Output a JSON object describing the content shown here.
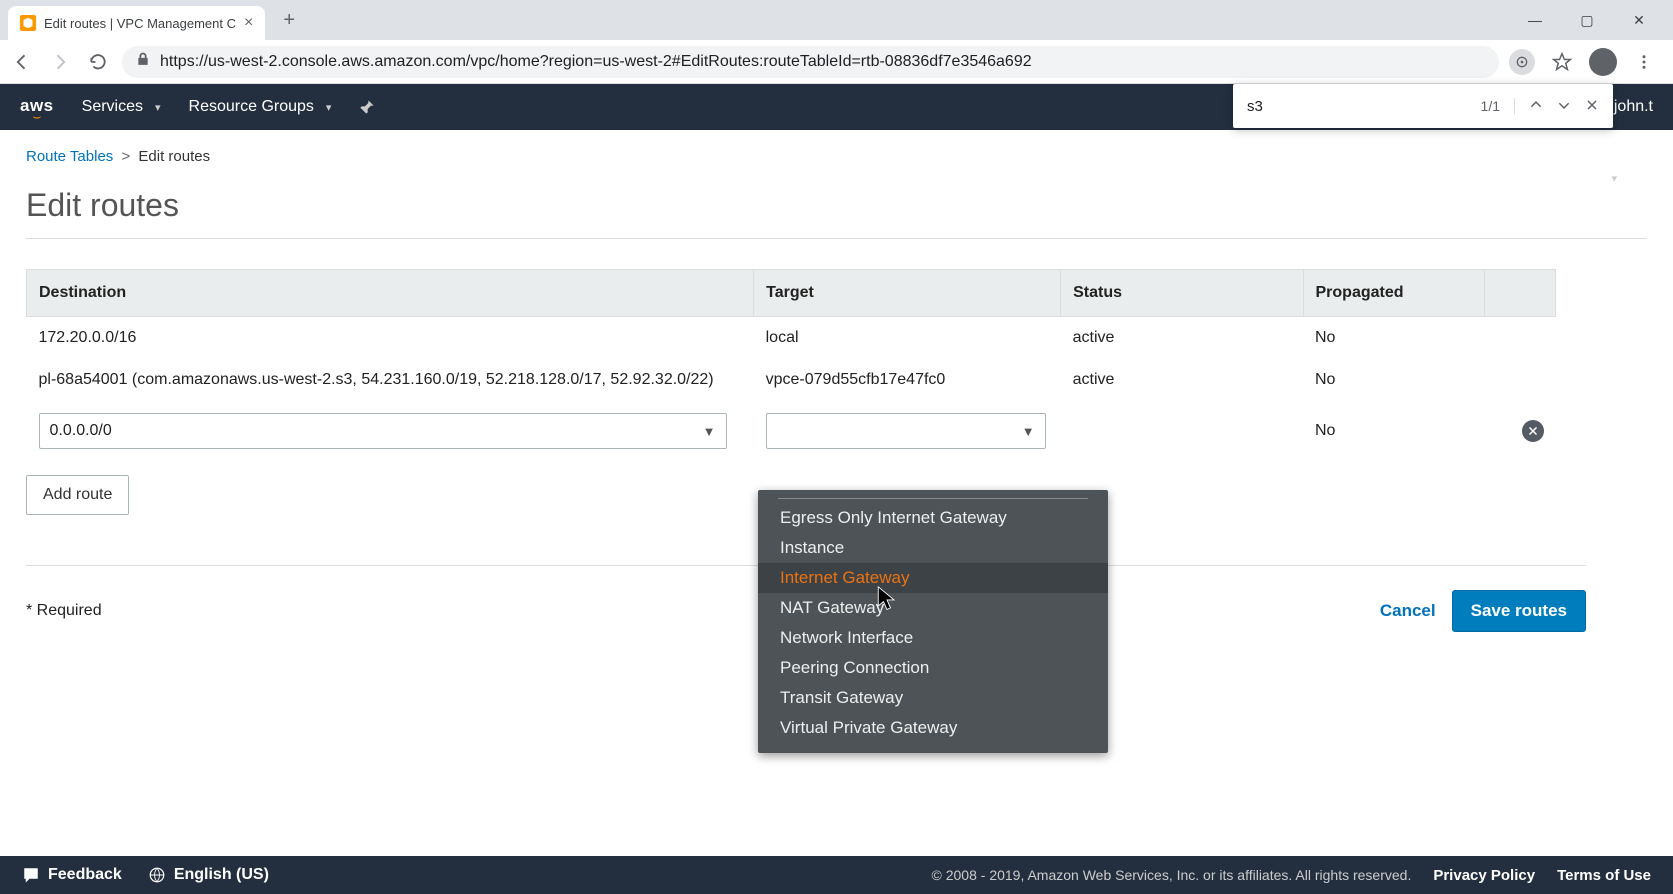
{
  "browser": {
    "tab_title": "Edit routes | VPC Management C",
    "url_display": "https://us-west-2.console.aws.amazon.com/vpc/home?region=us-west-2#EditRoutes:routeTableId=rtb-08836df7e3546a692",
    "find": {
      "query": "s3",
      "count": "1/1"
    }
  },
  "header": {
    "logo_text": "aws",
    "services_label": "Services",
    "resource_groups_label": "Resource Groups",
    "user_text": "john.t"
  },
  "page": {
    "breadcrumb_root": "Route Tables",
    "breadcrumb_current": "Edit routes",
    "title": "Edit routes",
    "columns": {
      "destination": "Destination",
      "target": "Target",
      "status": "Status",
      "propagated": "Propagated"
    },
    "rows": [
      {
        "destination": "172.20.0.0/16",
        "target": "local",
        "target_link": false,
        "status": "active",
        "propagated": "No",
        "editable": false
      },
      {
        "destination": "pl-68a54001 (com.amazonaws.us-west-2.s3, 54.231.160.0/19, 52.218.128.0/17, 52.92.32.0/22)",
        "target": "vpce-079d55cfb17e47fc0",
        "target_link": true,
        "status": "active",
        "propagated": "No",
        "editable": false
      },
      {
        "destination": "0.0.0.0/0",
        "target": "",
        "target_link": false,
        "status": "",
        "propagated": "No",
        "editable": true
      }
    ],
    "add_route_label": "Add route",
    "required_label": "* Required",
    "cancel_label": "Cancel",
    "save_label": "Save routes"
  },
  "dropdown": {
    "items": [
      "Egress Only Internet Gateway",
      "Instance",
      "Internet Gateway",
      "NAT Gateway",
      "Network Interface",
      "Peering Connection",
      "Transit Gateway",
      "Virtual Private Gateway"
    ],
    "highlighted_index": 2
  },
  "footer": {
    "feedback": "Feedback",
    "language": "English (US)",
    "copyright": "© 2008 - 2019, Amazon Web Services, Inc. or its affiliates. All rights reserved.",
    "privacy": "Privacy Policy",
    "terms": "Terms of Use"
  }
}
